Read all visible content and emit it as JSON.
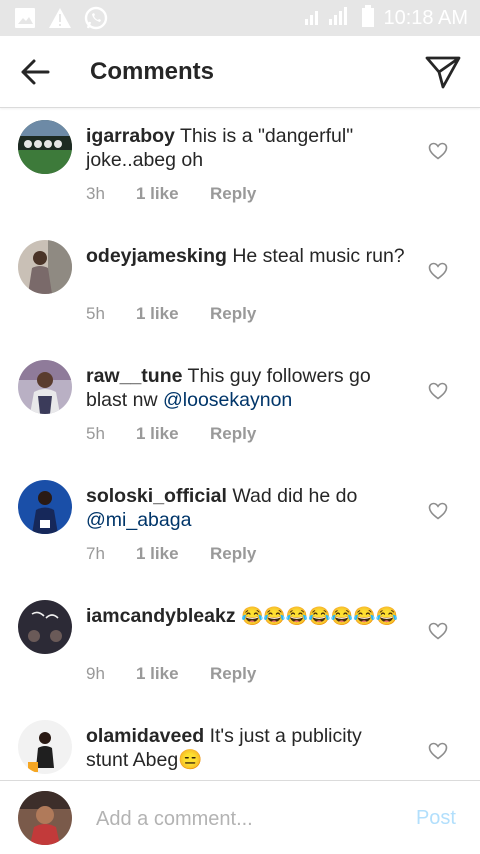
{
  "status_bar": {
    "time": "10:18 AM",
    "icons": [
      "image-icon",
      "warning-icon",
      "whatsapp-icon",
      "signal-icon",
      "battery-icon"
    ]
  },
  "header": {
    "title": "Comments",
    "back_icon": "arrow-left-icon",
    "send_icon": "paper-plane-icon"
  },
  "comments": [
    {
      "username": "igarraboy",
      "text": "This is a \"dangerful\" joke..abeg oh",
      "time": "3h",
      "likes": "1 like",
      "reply": "Reply"
    },
    {
      "username": "odeyjamesking",
      "text": "He steal music run?",
      "time": "5h",
      "likes": "1 like",
      "reply": "Reply"
    },
    {
      "username": "raw__tune",
      "text": "This guy followers go blast nw",
      "mention": "@loosekaynon",
      "time": "5h",
      "likes": "1 like",
      "reply": "Reply"
    },
    {
      "username": "soloski_official",
      "text": "Wad did he do",
      "mention": "@mi_abaga",
      "time": "7h",
      "likes": "1 like",
      "reply": "Reply"
    },
    {
      "username": "iamcandybleakz",
      "text": "😂😂😂😂😂😂😂",
      "time": "9h",
      "likes": "1 like",
      "reply": "Reply"
    },
    {
      "username": "olamidaveed",
      "text": "It's just a publicity stunt Abeg😑",
      "time": "",
      "likes": "",
      "reply": ""
    }
  ],
  "composer": {
    "placeholder": "Add a comment...",
    "post_label": "Post"
  },
  "colors": {
    "text": "#262626",
    "meta": "#999999",
    "mention": "#003569",
    "post_disabled": "#b2dffc",
    "status_bar": "#e6e6e6"
  }
}
